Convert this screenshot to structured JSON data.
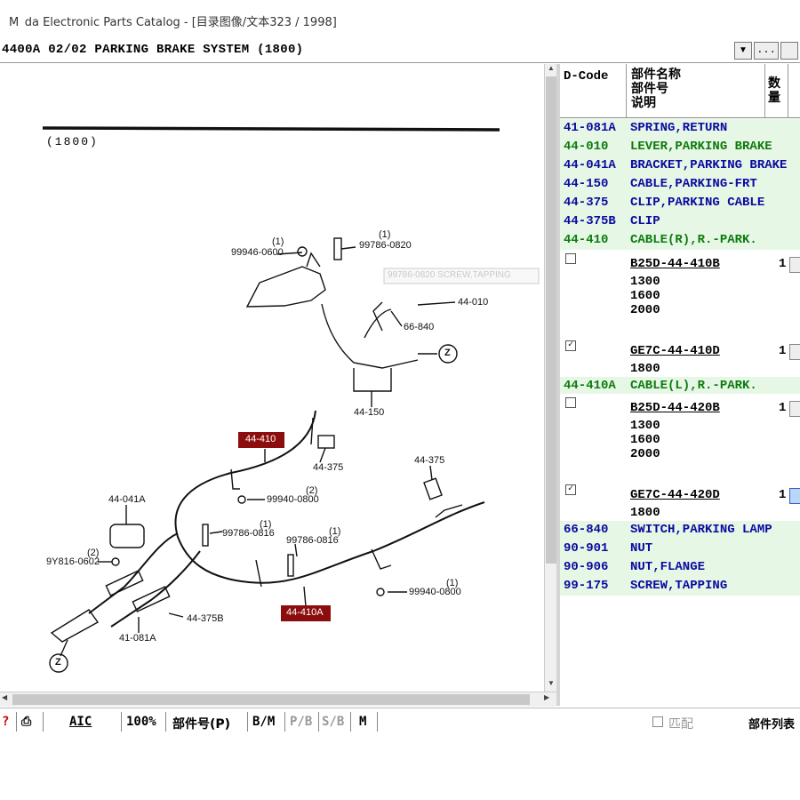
{
  "window": {
    "title": "M   da Electronic Parts Catalog - [目录图像/文本323 / 1998]"
  },
  "path_bar": {
    "text": "4400A 02/02 PARKING BRAKE SYSTEM (1800)",
    "dropdown_icon": "chevron-down-icon",
    "more_label": "..."
  },
  "diagram": {
    "caption": "(1800)",
    "labels": {
      "l_99946": "99946-0600",
      "l_99946q": "(1)",
      "l_99786a": "99786-0820",
      "l_99786aq": "(1)",
      "l_screw_tip": "99786-0820 SCREW,TAPPING",
      "l_44010": "44-010",
      "l_66840": "66-840",
      "l_44150": "44-150",
      "l_z1": "Z",
      "l_44410": "44-410",
      "l_44375a": "44-375",
      "l_44375b": "44-375",
      "l_99940a": "99940-0800",
      "l_99940aq": "(2)",
      "l_44041a": "44-041A",
      "l_99786b": "99786-0816",
      "l_99786bq": "(1)",
      "l_99786c": "99786-0816",
      "l_99786cq": "(1)",
      "l_9y816": "9Y816-0602",
      "l_9y816q": "(2)",
      "l_44410a": "44-410A",
      "l_99940b": "99940-0800",
      "l_99940bq": "(1)",
      "l_44375b2": "44-375B",
      "l_41081a": "41-081A",
      "l_z2": "Z"
    }
  },
  "parts_table": {
    "headers": {
      "dcode": "D-Code",
      "name_l1": "部件名称",
      "name_l2": "部件号",
      "name_l3": "说明",
      "qty": "数量"
    },
    "rows": [
      {
        "code": "41-081A",
        "name": "SPRING,RETURN"
      },
      {
        "code": "44-010",
        "name": "LEVER,PARKING BRAKE"
      },
      {
        "code": "44-041A",
        "name": "BRACKET,PARKING BRAKE"
      },
      {
        "code": "44-150",
        "name": "CABLE,PARKING-FRT"
      },
      {
        "code": "44-375",
        "name": "CLIP,PARKING CABLE"
      },
      {
        "code": "44-375B",
        "name": "CLIP"
      },
      {
        "code": "44-410",
        "name": "CABLE(R),R.-PARK."
      },
      {
        "code": "44-410A",
        "name": "CABLE(L),R.-PARK."
      },
      {
        "code": "66-840",
        "name": "SWITCH,PARKING LAMP"
      },
      {
        "code": "90-901",
        "name": "NUT"
      },
      {
        "code": "90-906",
        "name": "NUT,FLANGE"
      },
      {
        "code": "99-175",
        "name": "SCREW,TAPPING"
      }
    ],
    "subitems": [
      {
        "checked": "",
        "part_no": "B25D-44-410B",
        "qty": "1",
        "years": [
          "1300",
          "1600",
          "2000"
        ]
      },
      {
        "checked": "✓",
        "part_no": "GE7C-44-410D",
        "qty": "1",
        "years": [
          "1800"
        ]
      },
      {
        "checked": "",
        "part_no": "B25D-44-420B",
        "qty": "1",
        "years": [
          "1300",
          "1600",
          "2000"
        ]
      },
      {
        "checked": "✓",
        "part_no": "GE7C-44-420D",
        "qty": "1",
        "years": [
          "1800"
        ]
      }
    ]
  },
  "status_bar": {
    "help": "?",
    "print_icon": "printer-icon",
    "aic": "AIC",
    "zoom": "100%",
    "part_no": "部件号(P)",
    "bm": "B/M",
    "pb": "P/B",
    "sb": "S/B",
    "m": "M",
    "match": "匹配",
    "part_list": "部件列表"
  },
  "colors": {
    "code_blue": "#0a0aa0",
    "code_green": "#0c7a0c",
    "row_bg": "#e6f7e6",
    "highlight_red": "#8b0d0d"
  }
}
